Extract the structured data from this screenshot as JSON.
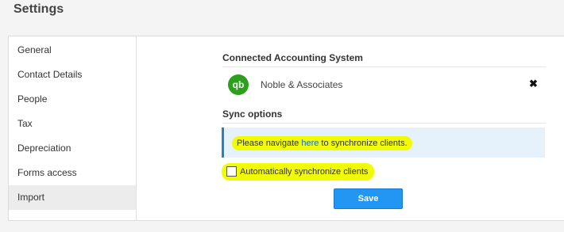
{
  "page": {
    "title": "Settings"
  },
  "sidebar": {
    "items": [
      {
        "label": "General"
      },
      {
        "label": "Contact Details"
      },
      {
        "label": "People"
      },
      {
        "label": "Tax"
      },
      {
        "label": "Depreciation"
      },
      {
        "label": "Forms access"
      },
      {
        "label": "Import",
        "active": true
      }
    ]
  },
  "connected": {
    "title": "Connected Accounting System",
    "logo_text": "qb",
    "company_name": "Noble & Associates",
    "remove_icon": "close-icon",
    "brand_color": "#2ca01c"
  },
  "sync": {
    "title": "Sync options",
    "info_prefix": "Please navigate ",
    "info_link": "here",
    "info_suffix": " to synchronize clients.",
    "auto_label": "Automatically synchronize clients",
    "auto_checked": false
  },
  "actions": {
    "save_label": "Save"
  },
  "colors": {
    "highlight": "#f0fb04",
    "info_border": "#2b80c5",
    "button": "#2196f3"
  }
}
